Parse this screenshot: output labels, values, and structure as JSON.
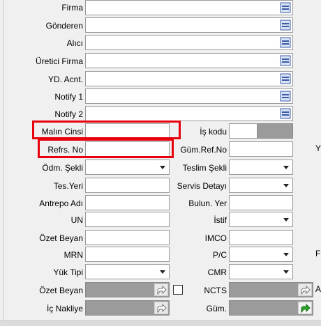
{
  "colors": {
    "highlight": "#e8000c",
    "disabled_field": "#9b9b9b",
    "lookup_icon": "#3b5ba5",
    "share_arrow_active": "#1a8a1a"
  },
  "lookup_rows": [
    {
      "label": "Firma",
      "value": ""
    },
    {
      "label": "Gönderen",
      "value": ""
    },
    {
      "label": "Alıcı",
      "value": ""
    },
    {
      "label": "Üretici Firma",
      "value": ""
    },
    {
      "label": "YD. Acnt.",
      "value": ""
    },
    {
      "label": "Notify 1",
      "value": ""
    },
    {
      "label": "Notify 2",
      "value": ""
    }
  ],
  "left_rows": [
    {
      "label": "Malın Cinsi",
      "value": ""
    },
    {
      "label": "Refrs. No",
      "value": ""
    },
    {
      "label": "Ödm. Şekli",
      "value": ""
    },
    {
      "label": "Tes.Yeri",
      "value": ""
    },
    {
      "label": "Antrepo Adı",
      "value": ""
    },
    {
      "label": "UN",
      "value": ""
    },
    {
      "label": "Özet Beyan",
      "value": ""
    },
    {
      "label": "MRN",
      "value": ""
    },
    {
      "label": "Yük Tipi",
      "value": ""
    },
    {
      "label": "Özet Beyan",
      "value": ""
    },
    {
      "label": "İç Nakliye",
      "value": ""
    }
  ],
  "right_rows": [
    {
      "label": "İş kodu",
      "value": ""
    },
    {
      "label": "Güm.Ref.No",
      "value": ""
    },
    {
      "label": "Teslim Şekli",
      "value": ""
    },
    {
      "label": "Servis Detayı",
      "value": ""
    },
    {
      "label": "Bulun. Yer",
      "value": ""
    },
    {
      "label": "İstif",
      "value": ""
    },
    {
      "label": "IMCO",
      "value": ""
    },
    {
      "label": "P/C",
      "value": ""
    },
    {
      "label": "CMR",
      "value": ""
    },
    {
      "label": "NCTS",
      "value": ""
    },
    {
      "label": "Güm.",
      "value": ""
    }
  ],
  "clipped_edge": {
    "row2": "Y",
    "row8": "F",
    "row10": "A"
  },
  "icons": {
    "lookup": "lookup-list-icon",
    "share": "share-arrow-icon",
    "dropdown": "chevron-down-icon"
  }
}
